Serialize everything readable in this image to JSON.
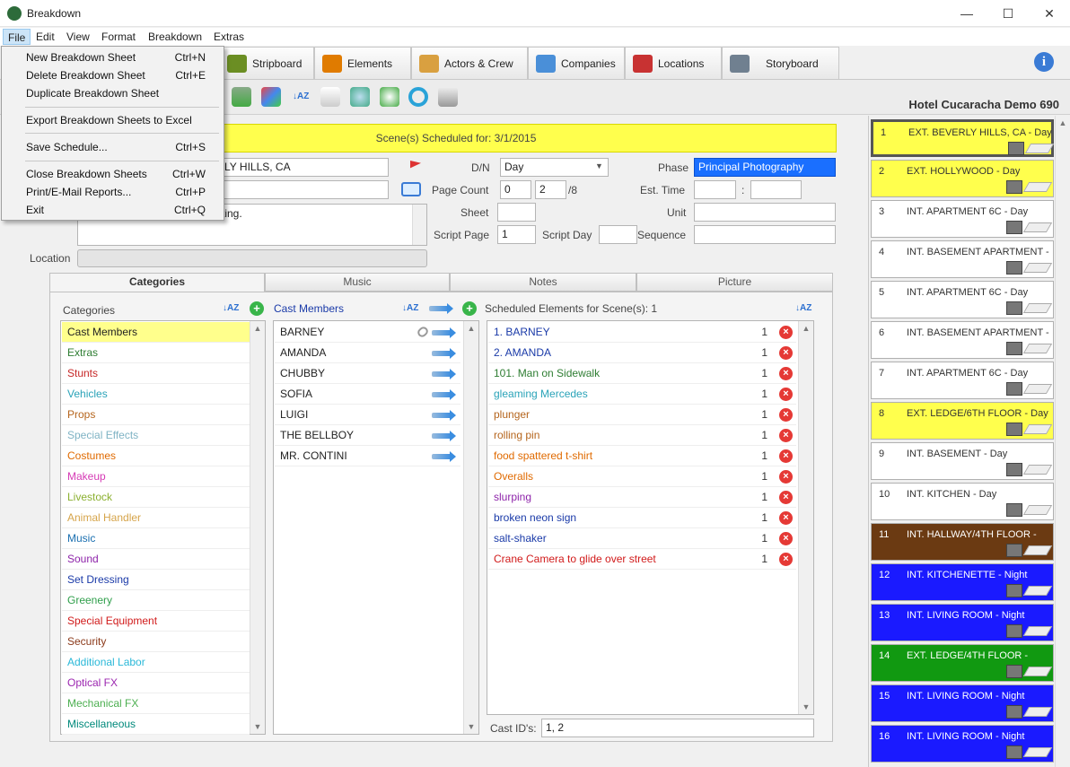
{
  "window": {
    "title": "Breakdown",
    "min": "—",
    "max": "☐",
    "close": "✕"
  },
  "menubar": [
    "File",
    "Edit",
    "View",
    "Format",
    "Breakdown",
    "Extras"
  ],
  "file_menu": {
    "items": [
      {
        "label": "New Breakdown Sheet",
        "shortcut": "Ctrl+N"
      },
      {
        "label": "Delete Breakdown Sheet",
        "shortcut": "Ctrl+E"
      },
      {
        "label": "Duplicate Breakdown Sheet",
        "shortcut": ""
      },
      {
        "label": "Export Breakdown Sheets to Excel",
        "shortcut": ""
      },
      {
        "label": "Save Schedule...",
        "shortcut": "Ctrl+S"
      },
      {
        "label": "Close Breakdown Sheets",
        "shortcut": "Ctrl+W"
      },
      {
        "label": "Print/E-Mail Reports...",
        "shortcut": "Ctrl+P"
      },
      {
        "label": "Exit",
        "shortcut": "Ctrl+Q"
      }
    ]
  },
  "top_tabs": [
    {
      "label": "Stripboard",
      "color": "#6b8e23"
    },
    {
      "label": "Elements",
      "color": "#e07b00"
    },
    {
      "label": "Actors & Crew",
      "color": "#d9a040"
    },
    {
      "label": "Companies",
      "color": "#4a8fd8"
    },
    {
      "label": "Locations",
      "color": "#c83232"
    },
    {
      "label": "Storyboard",
      "color": "#708090"
    }
  ],
  "project_title": "Hotel Cucaracha Demo 690",
  "scene_scheduled": "Scene(s) Scheduled for: 3/1/2015",
  "form": {
    "set_value": "LY HILLS, CA",
    "description_value": "ting.",
    "dn_label": "D/N",
    "dn_value": "Day",
    "phase_label": "Phase",
    "phase_value": "Principal Photography",
    "page_count_label": "Page Count",
    "page_count_whole": "0",
    "page_count_eighths": "2",
    "page_count_suffix": "/8",
    "est_time_label": "Est. Time",
    "est_time_sep": ":",
    "sheet_label": "Sheet",
    "unit_label": "Unit",
    "script_page_label": "Script Page",
    "script_page_value": "1",
    "script_day_label": "Script Day",
    "sequence_label": "Sequence",
    "location_label": "Location"
  },
  "subtabs": [
    "Categories",
    "Music",
    "Notes",
    "Picture"
  ],
  "categories_header": "Categories",
  "categories": [
    {
      "label": "Cast Members",
      "color": "#222"
    },
    {
      "label": "Extras",
      "color": "#2e7d32"
    },
    {
      "label": "Stunts",
      "color": "#c62828"
    },
    {
      "label": "Vehicles",
      "color": "#2aa3b8"
    },
    {
      "label": "Props",
      "color": "#b5651d"
    },
    {
      "label": "Special Effects",
      "color": "#7fb3c4"
    },
    {
      "label": "Costumes",
      "color": "#e06a00"
    },
    {
      "label": "Makeup",
      "color": "#d63ab5"
    },
    {
      "label": "Livestock",
      "color": "#8bb030"
    },
    {
      "label": "Animal Handler",
      "color": "#d6a44a"
    },
    {
      "label": "Music",
      "color": "#1a6fb0"
    },
    {
      "label": "Sound",
      "color": "#8e24aa"
    },
    {
      "label": "Set Dressing",
      "color": "#1a3aa8"
    },
    {
      "label": "Greenery",
      "color": "#2e9e4a"
    },
    {
      "label": "Special Equipment",
      "color": "#d11a1a"
    },
    {
      "label": "Security",
      "color": "#8b3a1a"
    },
    {
      "label": "Additional Labor",
      "color": "#2ab8d8"
    },
    {
      "label": "Optical FX",
      "color": "#9c27b0"
    },
    {
      "label": "Mechanical FX",
      "color": "#4caf50"
    },
    {
      "label": "Miscellaneous",
      "color": "#00897b"
    }
  ],
  "cast_header": "Cast Members",
  "cast": [
    "BARNEY",
    "AMANDA",
    "CHUBBY",
    "SOFIA",
    "LUIGI",
    "THE BELLBOY",
    "MR. CONTINI"
  ],
  "scheduled_header": "Scheduled Elements for Scene(s): 1",
  "scheduled": [
    {
      "label": "1. BARNEY",
      "qty": "1",
      "color": "#1a3aa8"
    },
    {
      "label": "2. AMANDA",
      "qty": "1",
      "color": "#1a3aa8"
    },
    {
      "label": "101. Man on Sidewalk",
      "qty": "1",
      "color": "#2e7d32"
    },
    {
      "label": "gleaming Mercedes",
      "qty": "1",
      "color": "#2aa3b8"
    },
    {
      "label": "plunger",
      "qty": "1",
      "color": "#b5651d"
    },
    {
      "label": "rolling pin",
      "qty": "1",
      "color": "#b5651d"
    },
    {
      "label": "food spattered t-shirt",
      "qty": "1",
      "color": "#e06a00"
    },
    {
      "label": "Overalls",
      "qty": "1",
      "color": "#e06a00"
    },
    {
      "label": "slurping",
      "qty": "1",
      "color": "#8e24aa"
    },
    {
      "label": "broken neon sign",
      "qty": "1",
      "color": "#1a3aa8"
    },
    {
      "label": "salt-shaker",
      "qty": "1",
      "color": "#1a3aa8"
    },
    {
      "label": "Crane Camera to glide over street",
      "qty": "1",
      "color": "#d11a1a"
    }
  ],
  "cast_ids_label": "Cast ID's:",
  "cast_ids_value": "1, 2",
  "strips": [
    {
      "num": "1",
      "text": "EXT. BEVERLY HILLS, CA  - Day",
      "bg": "#ffff4d",
      "fg": "#333"
    },
    {
      "num": "2",
      "text": "EXT. HOLLYWOOD  - Day",
      "bg": "#ffff4d",
      "fg": "#333"
    },
    {
      "num": "3",
      "text": "INT. APARTMENT 6C  - Day",
      "bg": "#ffffff",
      "fg": "#333"
    },
    {
      "num": "4",
      "text": "INT. BASEMENT APARTMENT  -",
      "bg": "#ffffff",
      "fg": "#333"
    },
    {
      "num": "5",
      "text": "INT. APARTMENT 6C  - Day",
      "bg": "#ffffff",
      "fg": "#333"
    },
    {
      "num": "6",
      "text": "INT. BASEMENT APARTMENT  -",
      "bg": "#ffffff",
      "fg": "#333"
    },
    {
      "num": "7",
      "text": "INT. APARTMENT 6C  - Day",
      "bg": "#ffffff",
      "fg": "#333"
    },
    {
      "num": "8",
      "text": "EXT. LEDGE/6TH FLOOR  - Day",
      "bg": "#ffff4d",
      "fg": "#333"
    },
    {
      "num": "9",
      "text": "INT. BASEMENT  - Day",
      "bg": "#ffffff",
      "fg": "#333"
    },
    {
      "num": "10",
      "text": "INT. KITCHEN  - Day",
      "bg": "#ffffff",
      "fg": "#333"
    },
    {
      "num": "11",
      "text": "INT. HALLWAY/4TH FLOOR  -",
      "bg": "#6b3a12",
      "fg": "#fff"
    },
    {
      "num": "12",
      "text": "INT. KITCHENETTE  - Night",
      "bg": "#1a1aff",
      "fg": "#fff"
    },
    {
      "num": "13",
      "text": "INT. LIVING ROOM  - Night",
      "bg": "#1a1aff",
      "fg": "#fff"
    },
    {
      "num": "14",
      "text": "EXT. LEDGE/4TH FLOOR  -",
      "bg": "#119911",
      "fg": "#fff"
    },
    {
      "num": "15",
      "text": "INT. LIVING ROOM  - Night",
      "bg": "#1a1aff",
      "fg": "#fff"
    },
    {
      "num": "16",
      "text": "INT. LIVING ROOM  - Night",
      "bg": "#1a1aff",
      "fg": "#fff"
    }
  ],
  "sort_icon_text": "↓AZ",
  "plus_glyph": "+",
  "delete_glyph": "×",
  "info_glyph": "i"
}
